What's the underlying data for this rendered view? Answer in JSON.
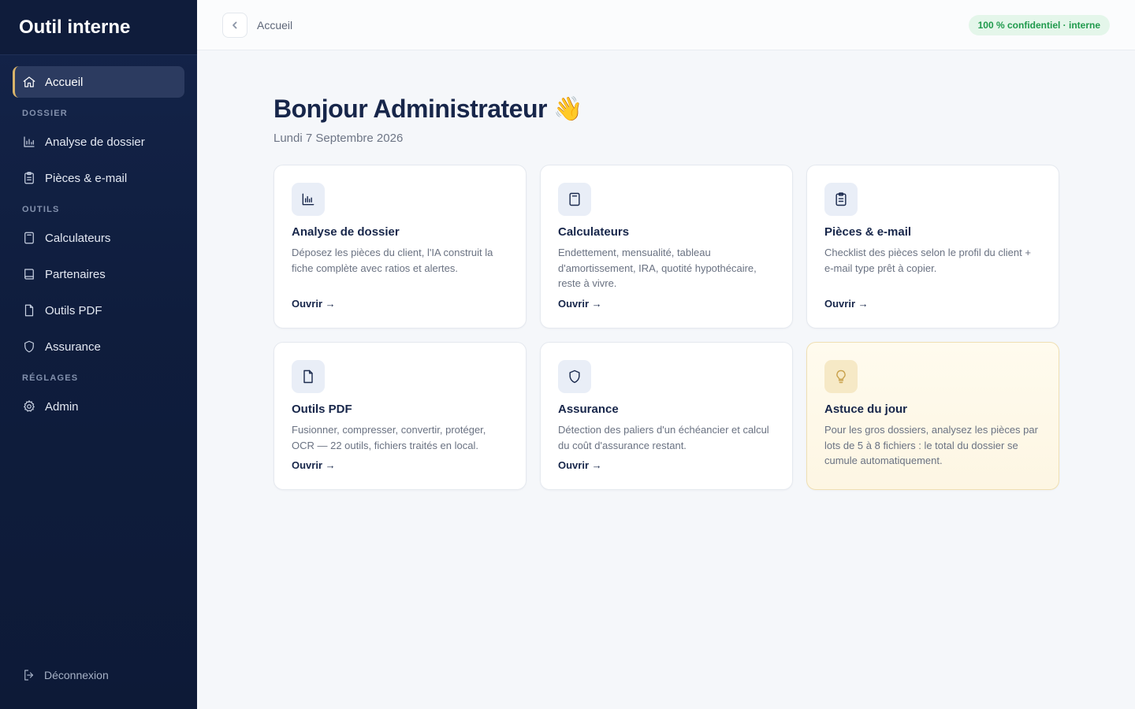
{
  "brand": "Outil interne",
  "sidebar": {
    "items": [
      {
        "label": "Accueil",
        "icon": "home-icon",
        "active": true
      },
      {
        "section": "DOSSIER"
      },
      {
        "label": "Analyse de dossier",
        "icon": "bar-chart-icon"
      },
      {
        "label": "Pièces & e-mail",
        "icon": "clipboard-icon"
      },
      {
        "section": "OUTILS"
      },
      {
        "label": "Calculateurs",
        "icon": "calculator-icon"
      },
      {
        "label": "Partenaires",
        "icon": "book-icon"
      },
      {
        "label": "Outils PDF",
        "icon": "file-icon"
      },
      {
        "label": "Assurance",
        "icon": "shield-icon"
      },
      {
        "section": "RÉGLAGES"
      },
      {
        "label": "Admin",
        "icon": "gear-icon"
      }
    ],
    "logout_label": "Déconnexion"
  },
  "topbar": {
    "breadcrumb": "Accueil",
    "badge": "100 % confidentiel · interne"
  },
  "main": {
    "greeting": "Bonjour Administrateur",
    "greeting_emoji": "👋",
    "date": "Lundi 7 Septembre 2026"
  },
  "cards": [
    {
      "title": "Analyse de dossier",
      "desc": "Déposez les pièces du client, l'IA construit la fiche complète avec ratios et alertes.",
      "link": "Ouvrir →",
      "icon": "bar-chart-icon"
    },
    {
      "title": "Calculateurs",
      "desc": "Endettement, mensualité, tableau d'amortissement, IRA, quotité hypothécaire, reste à vivre.",
      "link": "Ouvrir →",
      "icon": "calculator-icon"
    },
    {
      "title": "Pièces & e-mail",
      "desc": "Checklist des pièces selon le profil du client + e-mail type prêt à copier.",
      "link": "Ouvrir →",
      "icon": "clipboard-icon"
    },
    {
      "title": "Outils PDF",
      "desc": "Fusionner, compresser, convertir, protéger, OCR — 22 outils, fichiers traités en local.",
      "link": "Ouvrir →",
      "icon": "file-icon"
    },
    {
      "title": "Assurance",
      "desc": "Détection des paliers d'un échéancier et calcul du coût d'assurance restant.",
      "link": "Ouvrir →",
      "icon": "shield-icon"
    },
    {
      "title": "Astuce du jour",
      "desc": "Pour les gros dossiers, analysez les pièces par lots de 5 à 8 fichiers : le total du dossier se cumule automatiquement.",
      "icon": "lightbulb-icon"
    }
  ],
  "colors": {
    "sidebar_bg": "#0f1d3d",
    "accent": "#d9b46a",
    "badge_text": "#1f9a4c",
    "badge_bg": "#e4f6ea"
  }
}
